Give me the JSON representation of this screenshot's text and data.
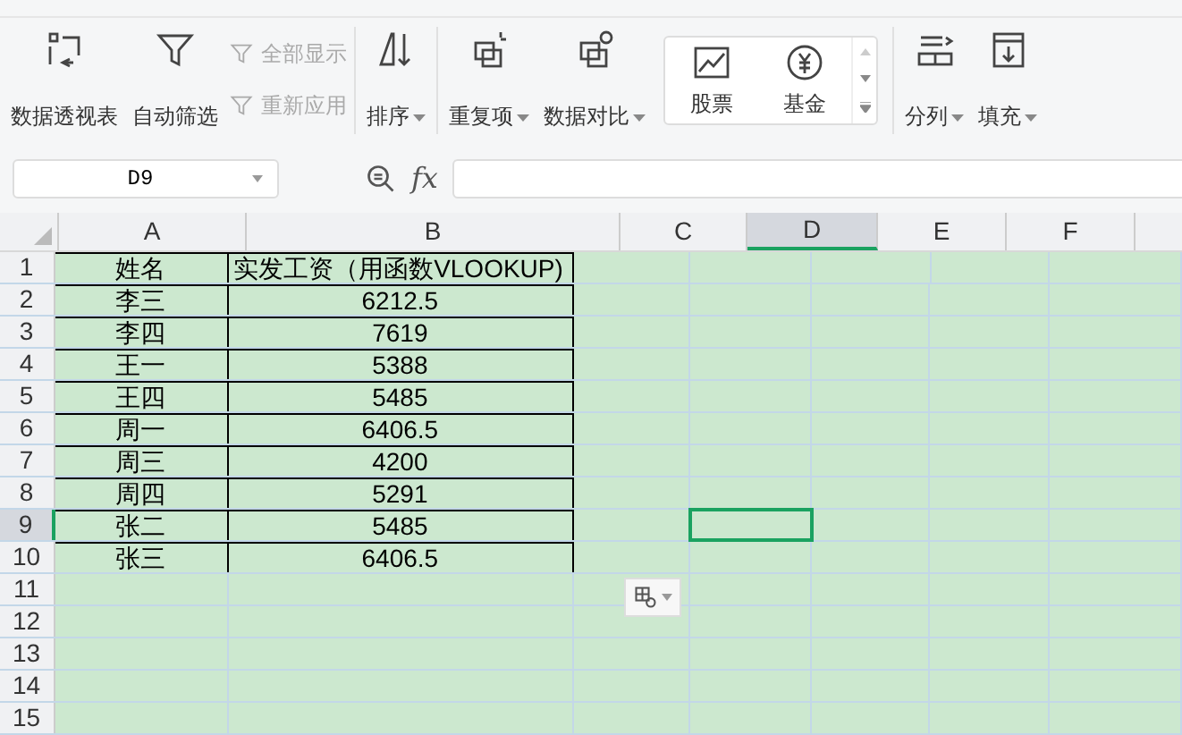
{
  "ribbon": {
    "items": [
      {
        "label": "数据透视表",
        "kind": "large"
      },
      {
        "label": "自动筛选",
        "kind": "large"
      },
      {
        "label": "全部显示",
        "kind": "small",
        "disabled": true
      },
      {
        "label": "重新应用",
        "kind": "small",
        "disabled": true
      },
      {
        "label": "排序",
        "kind": "large",
        "caret": true
      },
      {
        "label": "重复项",
        "kind": "large",
        "caret": true
      },
      {
        "label": "数据对比",
        "kind": "large",
        "caret": true
      },
      {
        "label": "股票",
        "kind": "gallery"
      },
      {
        "label": "基金",
        "kind": "gallery"
      },
      {
        "label": "分列",
        "kind": "large",
        "caret": true
      },
      {
        "label": "填充",
        "kind": "large",
        "caret": true
      }
    ]
  },
  "name_box": {
    "value": "D9"
  },
  "formula_bar": {
    "fx": "fx"
  },
  "sheet": {
    "columns": [
      {
        "label": "A",
        "selected": false
      },
      {
        "label": "B",
        "selected": false
      },
      {
        "label": "C",
        "selected": false
      },
      {
        "label": "D",
        "selected": true
      },
      {
        "label": "E",
        "selected": false
      },
      {
        "label": "F",
        "selected": false
      }
    ],
    "rows": [
      {
        "label": "1",
        "selected": false,
        "cells": [
          "姓名",
          "实发工资（用函数VLOOKUP)"
        ]
      },
      {
        "label": "2",
        "selected": false,
        "cells": [
          "李三",
          "6212.5"
        ]
      },
      {
        "label": "3",
        "selected": false,
        "cells": [
          "李四",
          "7619"
        ]
      },
      {
        "label": "4",
        "selected": false,
        "cells": [
          "王一",
          "5388"
        ]
      },
      {
        "label": "5",
        "selected": false,
        "cells": [
          "王四",
          "5485"
        ]
      },
      {
        "label": "6",
        "selected": false,
        "cells": [
          "周一",
          "6406.5"
        ]
      },
      {
        "label": "7",
        "selected": false,
        "cells": [
          "周三",
          "4200"
        ]
      },
      {
        "label": "8",
        "selected": false,
        "cells": [
          "周四",
          "5291"
        ]
      },
      {
        "label": "9",
        "selected": true,
        "cells": [
          "张二",
          "5485"
        ]
      },
      {
        "label": "10",
        "selected": false,
        "cells": [
          "张三",
          "6406.5"
        ]
      },
      {
        "label": "11",
        "selected": false,
        "cells": []
      },
      {
        "label": "12",
        "selected": false,
        "cells": []
      },
      {
        "label": "13",
        "selected": false,
        "cells": []
      },
      {
        "label": "14",
        "selected": false,
        "cells": []
      },
      {
        "label": "15",
        "selected": false,
        "cells": []
      }
    ]
  }
}
